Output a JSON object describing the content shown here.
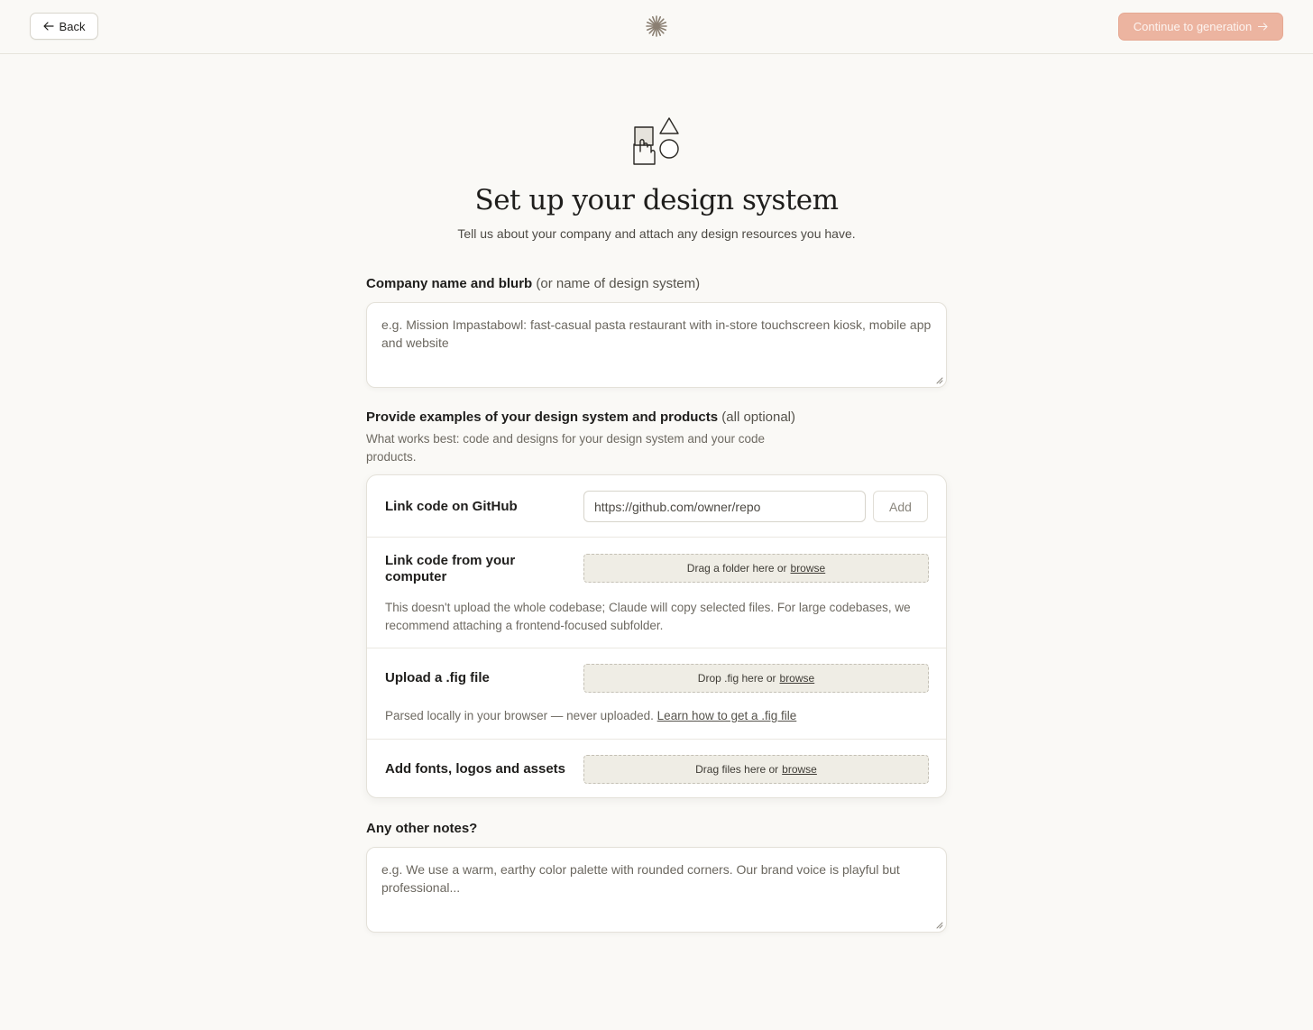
{
  "topbar": {
    "back_label": "Back",
    "continue_label": "Continue to generation",
    "accent_color": "#ecb4a0"
  },
  "header": {
    "title": "Set up your design system",
    "subtitle": "Tell us about your company and attach any design resources you have."
  },
  "company": {
    "label": "Company name and blurb",
    "label_muted": "(or name of design system)",
    "placeholder": "e.g. Mission Impastabowl: fast-casual pasta restaurant with in-store touchscreen kiosk, mobile app and website"
  },
  "examples": {
    "label": "Provide examples of your design system and products",
    "label_muted": "(all optional)",
    "helper": "What works best: code and designs for your design system and your code products.",
    "github": {
      "title": "Link code on GitHub",
      "placeholder": "https://github.com/owner/repo",
      "add_label": "Add"
    },
    "computer": {
      "title": "Link code from your computer",
      "drop_text": "Drag a folder here or",
      "browse_label": "browse",
      "note": "This doesn't upload the whole codebase; Claude will copy selected files. For large codebases, we recommend attaching a frontend-focused subfolder."
    },
    "fig": {
      "title": "Upload a .fig file",
      "drop_text": "Drop .fig here or",
      "browse_label": "browse",
      "note": "Parsed locally in your browser — never uploaded.",
      "learn_link": "Learn how to get a .fig file"
    },
    "assets": {
      "title": "Add fonts, logos and assets",
      "drop_text": "Drag files here or",
      "browse_label": "browse"
    }
  },
  "notes": {
    "label": "Any other notes?",
    "placeholder": "e.g. We use a warm, earthy color palette with rounded corners. Our brand voice is playful but professional..."
  }
}
